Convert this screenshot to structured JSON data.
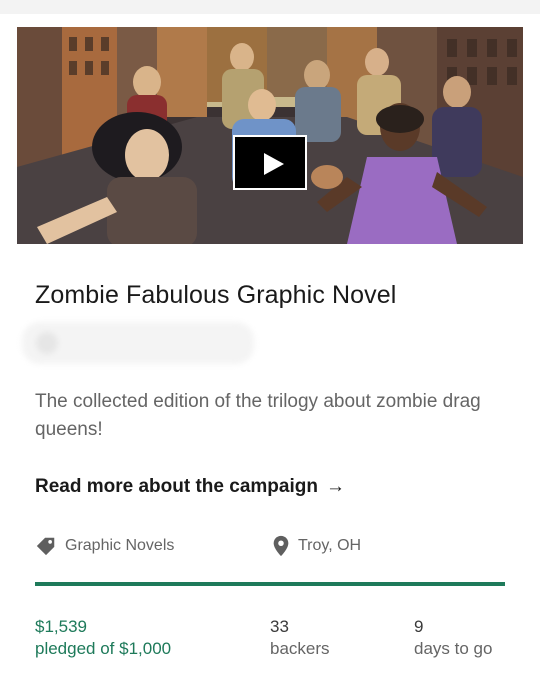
{
  "project": {
    "title": "Zombie Fabulous Graphic Novel",
    "blurb": "The collected edition of the trilogy about zombie drag queens!",
    "read_more_label": "Read more about the campaign",
    "read_more_arrow": "→"
  },
  "video": {
    "play_icon": "play-icon"
  },
  "meta": {
    "category": "Graphic Novels",
    "category_icon": "tag-icon",
    "location": "Troy, OH",
    "location_icon": "location-pin-icon"
  },
  "funding": {
    "progress_fraction": 1.0,
    "accent_color": "#1e7a5a"
  },
  "stats": {
    "pledged_value": "$1,539",
    "pledged_label": "pledged of $1,000",
    "backers_value": "33",
    "backers_label": "backers",
    "days_value": "9",
    "days_label": "days to go"
  }
}
